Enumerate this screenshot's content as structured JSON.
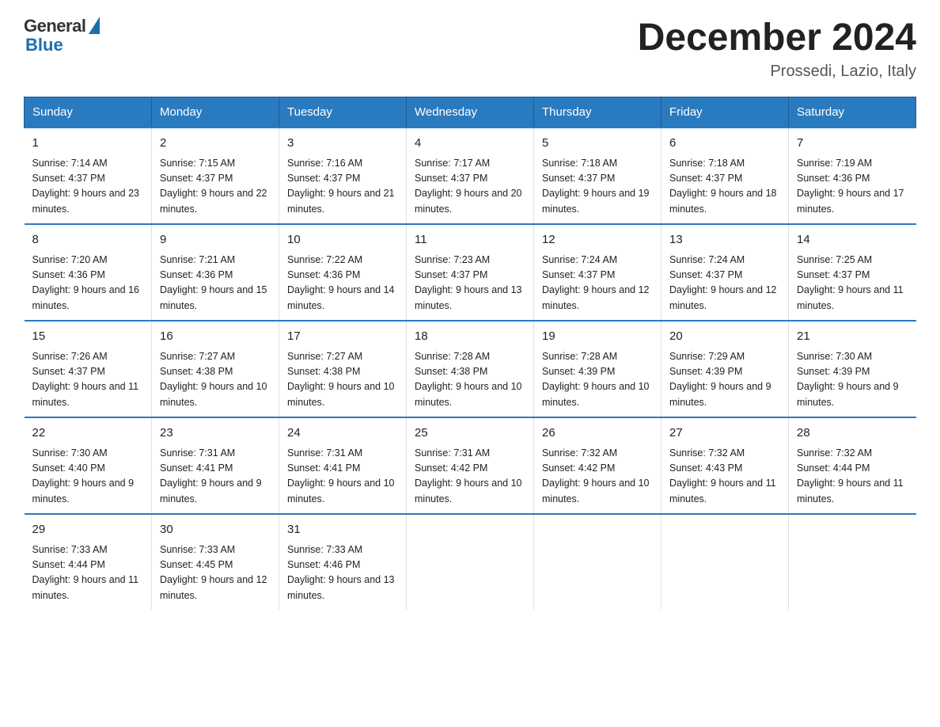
{
  "logo": {
    "general": "General",
    "blue": "Blue"
  },
  "title": "December 2024",
  "location": "Prossedi, Lazio, Italy",
  "headers": [
    "Sunday",
    "Monday",
    "Tuesday",
    "Wednesday",
    "Thursday",
    "Friday",
    "Saturday"
  ],
  "weeks": [
    [
      {
        "day": "1",
        "sunrise": "7:14 AM",
        "sunset": "4:37 PM",
        "daylight": "9 hours and 23 minutes."
      },
      {
        "day": "2",
        "sunrise": "7:15 AM",
        "sunset": "4:37 PM",
        "daylight": "9 hours and 22 minutes."
      },
      {
        "day": "3",
        "sunrise": "7:16 AM",
        "sunset": "4:37 PM",
        "daylight": "9 hours and 21 minutes."
      },
      {
        "day": "4",
        "sunrise": "7:17 AM",
        "sunset": "4:37 PM",
        "daylight": "9 hours and 20 minutes."
      },
      {
        "day": "5",
        "sunrise": "7:18 AM",
        "sunset": "4:37 PM",
        "daylight": "9 hours and 19 minutes."
      },
      {
        "day": "6",
        "sunrise": "7:18 AM",
        "sunset": "4:37 PM",
        "daylight": "9 hours and 18 minutes."
      },
      {
        "day": "7",
        "sunrise": "7:19 AM",
        "sunset": "4:36 PM",
        "daylight": "9 hours and 17 minutes."
      }
    ],
    [
      {
        "day": "8",
        "sunrise": "7:20 AM",
        "sunset": "4:36 PM",
        "daylight": "9 hours and 16 minutes."
      },
      {
        "day": "9",
        "sunrise": "7:21 AM",
        "sunset": "4:36 PM",
        "daylight": "9 hours and 15 minutes."
      },
      {
        "day": "10",
        "sunrise": "7:22 AM",
        "sunset": "4:36 PM",
        "daylight": "9 hours and 14 minutes."
      },
      {
        "day": "11",
        "sunrise": "7:23 AM",
        "sunset": "4:37 PM",
        "daylight": "9 hours and 13 minutes."
      },
      {
        "day": "12",
        "sunrise": "7:24 AM",
        "sunset": "4:37 PM",
        "daylight": "9 hours and 12 minutes."
      },
      {
        "day": "13",
        "sunrise": "7:24 AM",
        "sunset": "4:37 PM",
        "daylight": "9 hours and 12 minutes."
      },
      {
        "day": "14",
        "sunrise": "7:25 AM",
        "sunset": "4:37 PM",
        "daylight": "9 hours and 11 minutes."
      }
    ],
    [
      {
        "day": "15",
        "sunrise": "7:26 AM",
        "sunset": "4:37 PM",
        "daylight": "9 hours and 11 minutes."
      },
      {
        "day": "16",
        "sunrise": "7:27 AM",
        "sunset": "4:38 PM",
        "daylight": "9 hours and 10 minutes."
      },
      {
        "day": "17",
        "sunrise": "7:27 AM",
        "sunset": "4:38 PM",
        "daylight": "9 hours and 10 minutes."
      },
      {
        "day": "18",
        "sunrise": "7:28 AM",
        "sunset": "4:38 PM",
        "daylight": "9 hours and 10 minutes."
      },
      {
        "day": "19",
        "sunrise": "7:28 AM",
        "sunset": "4:39 PM",
        "daylight": "9 hours and 10 minutes."
      },
      {
        "day": "20",
        "sunrise": "7:29 AM",
        "sunset": "4:39 PM",
        "daylight": "9 hours and 9 minutes."
      },
      {
        "day": "21",
        "sunrise": "7:30 AM",
        "sunset": "4:39 PM",
        "daylight": "9 hours and 9 minutes."
      }
    ],
    [
      {
        "day": "22",
        "sunrise": "7:30 AM",
        "sunset": "4:40 PM",
        "daylight": "9 hours and 9 minutes."
      },
      {
        "day": "23",
        "sunrise": "7:31 AM",
        "sunset": "4:41 PM",
        "daylight": "9 hours and 9 minutes."
      },
      {
        "day": "24",
        "sunrise": "7:31 AM",
        "sunset": "4:41 PM",
        "daylight": "9 hours and 10 minutes."
      },
      {
        "day": "25",
        "sunrise": "7:31 AM",
        "sunset": "4:42 PM",
        "daylight": "9 hours and 10 minutes."
      },
      {
        "day": "26",
        "sunrise": "7:32 AM",
        "sunset": "4:42 PM",
        "daylight": "9 hours and 10 minutes."
      },
      {
        "day": "27",
        "sunrise": "7:32 AM",
        "sunset": "4:43 PM",
        "daylight": "9 hours and 11 minutes."
      },
      {
        "day": "28",
        "sunrise": "7:32 AM",
        "sunset": "4:44 PM",
        "daylight": "9 hours and 11 minutes."
      }
    ],
    [
      {
        "day": "29",
        "sunrise": "7:33 AM",
        "sunset": "4:44 PM",
        "daylight": "9 hours and 11 minutes."
      },
      {
        "day": "30",
        "sunrise": "7:33 AM",
        "sunset": "4:45 PM",
        "daylight": "9 hours and 12 minutes."
      },
      {
        "day": "31",
        "sunrise": "7:33 AM",
        "sunset": "4:46 PM",
        "daylight": "9 hours and 13 minutes."
      },
      null,
      null,
      null,
      null
    ]
  ],
  "labels": {
    "sunrise_prefix": "Sunrise: ",
    "sunset_prefix": "Sunset: ",
    "daylight_prefix": "Daylight: "
  }
}
